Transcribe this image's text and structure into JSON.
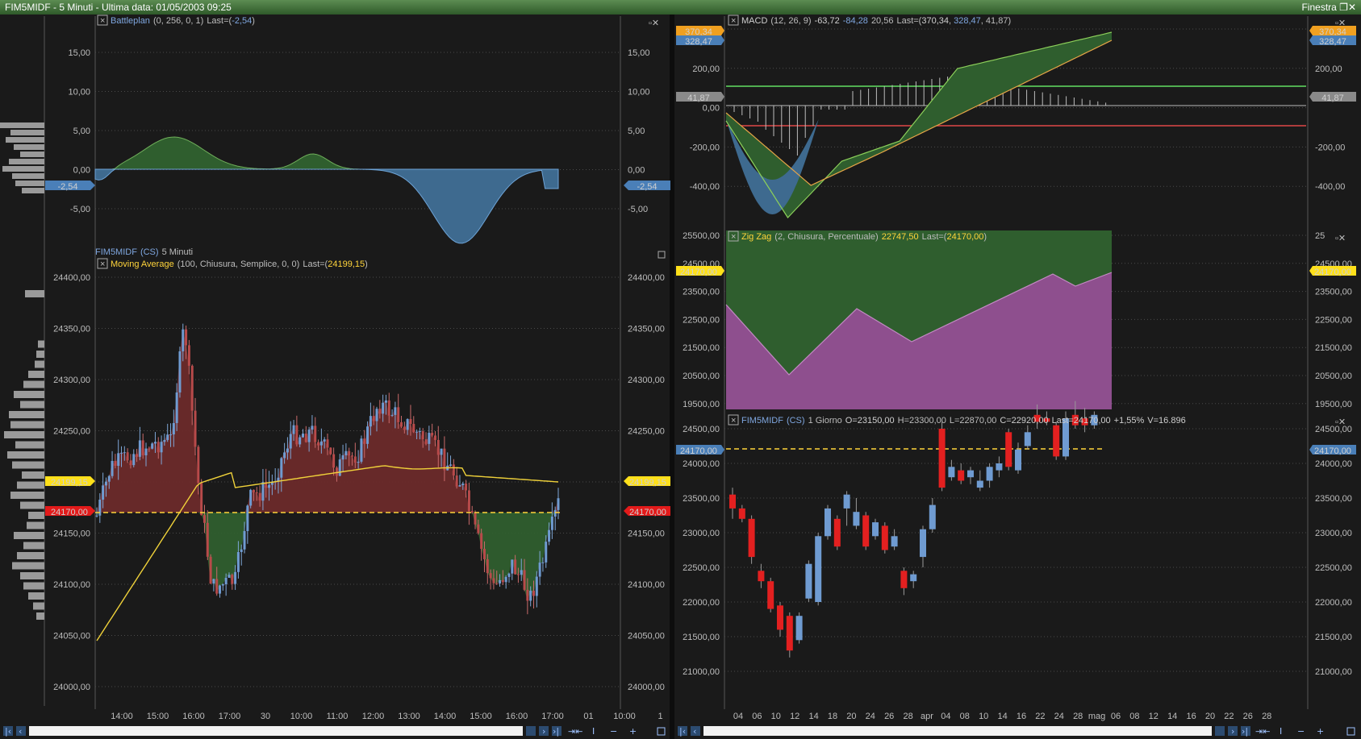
{
  "window": {
    "title": "FIM5MIDF - 5 Minuti - Ultima data: 01/05/2003  09:25",
    "menu_right": "Finestra"
  },
  "left": {
    "battleplan": {
      "name": "Battleplan",
      "params": "(0, 256, 0, 1)",
      "last_label": "Last=(",
      "last_value": "-2,54",
      "last_close": ")",
      "y_ticks": [
        "15,00",
        "10,00",
        "5,00",
        "0,00",
        "-5,00"
      ],
      "current_badge": "-2,54"
    },
    "main": {
      "symbol": "FIM5MIDF",
      "cs": "(CS)",
      "period": "5 Minuti",
      "ma_name": "Moving Average",
      "ma_params": "(100, Chiusura, Semplice, 0, 0)",
      "ma_last_label": "Last=(",
      "ma_last_value": "24199,15",
      "ma_last_close": ")",
      "y_ticks": [
        "24400,00",
        "24350,00",
        "24300,00",
        "24250,00",
        "24200,00",
        "24150,00",
        "24100,00",
        "24050,00",
        "24000,00"
      ],
      "badge_ma": "24199,15",
      "badge_price": "24170,00",
      "x_ticks": [
        "14:00",
        "15:00",
        "16:00",
        "17:00",
        "30",
        "10:00",
        "11:00",
        "12:00",
        "13:00",
        "14:00",
        "15:00",
        "16:00",
        "17:00",
        "01",
        "10:00",
        "1"
      ]
    }
  },
  "right": {
    "macd": {
      "name": "MACD",
      "params": "(12, 26, 9)",
      "v1": "-63,72",
      "v2": "-84,28",
      "v3": "20,56",
      "last_label": "Last=(",
      "last_v1": "370,34",
      "last_v2": "328,47",
      "last_v3": "41,87",
      "last_close": ")",
      "y_ticks": [
        "400,00",
        "200,00",
        "0,00",
        "-200,00",
        "-400,00"
      ],
      "y_ticks_right": [
        "200,00",
        "-200,00",
        "-400,00"
      ],
      "badge_orange": "370,34",
      "badge_blue": "328,47",
      "badge_grey": "41,87",
      "badge_right_top": "370,34"
    },
    "zigzag": {
      "name": "Zig Zag",
      "params": "(2, Chiusura, Percentuale)",
      "value": "22747,50",
      "last_label": "Last=(",
      "last_value": "24170,00",
      "last_close": ")",
      "y_ticks": [
        "25500,00",
        "24500,00",
        "23500,00",
        "22500,00",
        "21500,00",
        "20500,00",
        "19500,00"
      ],
      "y_ticks_right": [
        "25",
        "24500,00",
        "23500,00",
        "22500,00",
        "21500,00",
        "20500,00",
        "19500,00"
      ],
      "badge": "24170,00"
    },
    "daily": {
      "symbol": "FIM5MIDF",
      "cs": "(CS)",
      "period": "1 Giorno",
      "open": "O=23150,00",
      "high": "H=23300,00",
      "low": "L=22870,00",
      "close": "C=22920,00",
      "last": "Last=24170,00",
      "change": "+1,55%",
      "volume": "V=16.896",
      "y_ticks": [
        "24500,00",
        "24000,00",
        "23500,00",
        "23000,00",
        "22500,00",
        "22000,00",
        "21500,00",
        "21000,00"
      ],
      "y_ticks_right": [
        "24500,00",
        "24000,00",
        "23500,00",
        "23000,00",
        "22500,00",
        "22000,00",
        "21500,00",
        "21000,00"
      ],
      "badge": "24170,00",
      "x_ticks": [
        "04",
        "06",
        "10",
        "12",
        "14",
        "18",
        "20",
        "24",
        "26",
        "28",
        "apr",
        "04",
        "08",
        "10",
        "14",
        "16",
        "22",
        "24",
        "28",
        "mag",
        "06",
        "08",
        "12",
        "14",
        "16",
        "20",
        "22",
        "26",
        "28"
      ]
    }
  },
  "colors": {
    "background": "#1a1a1a",
    "grid": "#4a4a4a",
    "bull_area": "#2f5e2e",
    "bear_area": "#6b2a2a",
    "blue_area": "#3e6a8f",
    "candle_up": "#6f9bd1",
    "candle_down": "#e32020",
    "ma_line": "#f0d23a",
    "price_line": "#ffd43b",
    "macd_up_line": "#8ccf5a",
    "zigzag_fill": "#8e4f8e",
    "green_line": "#63e063",
    "red_line": "#e04848"
  }
}
